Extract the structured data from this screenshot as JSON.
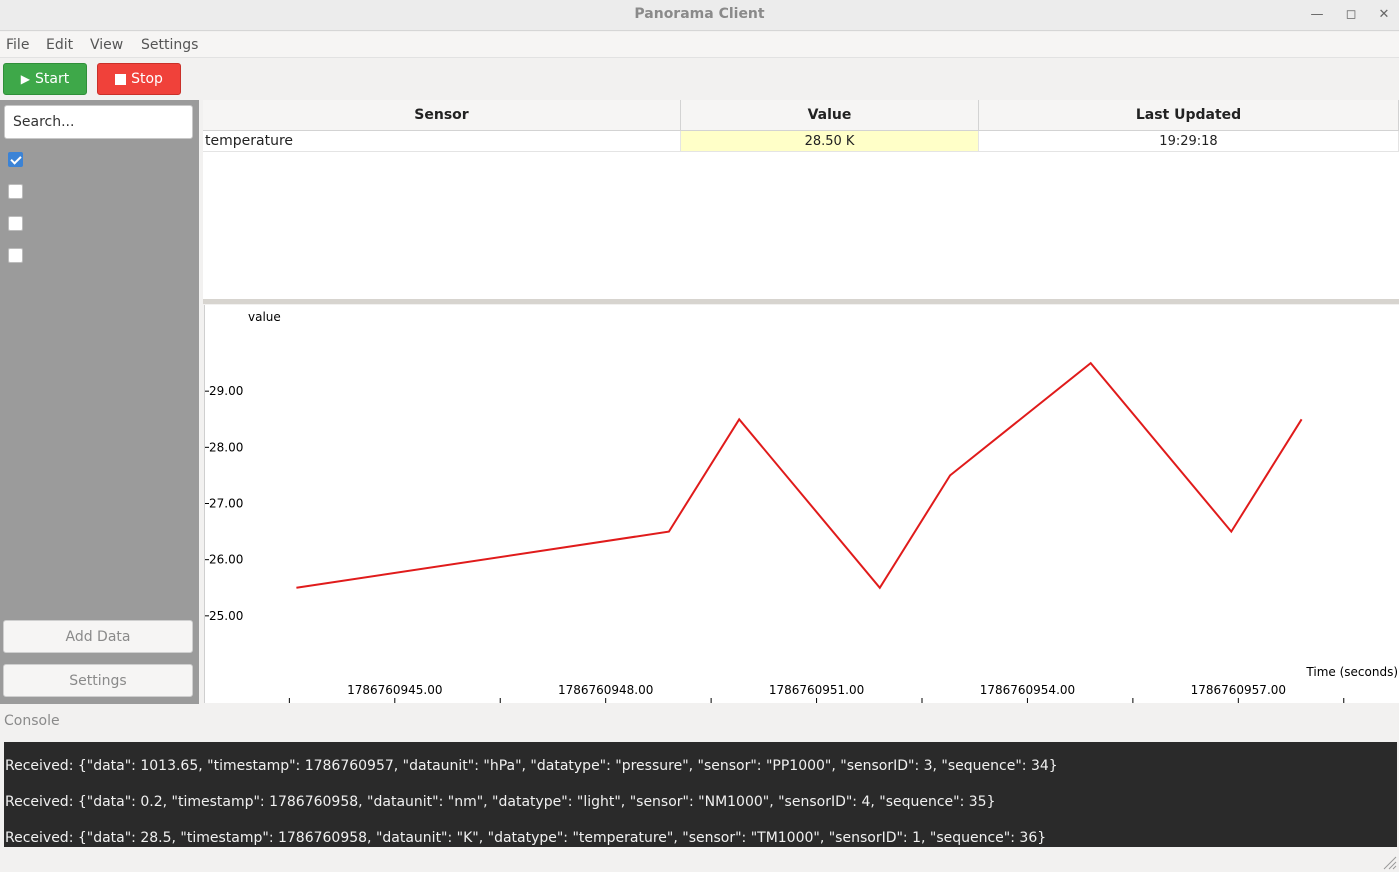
{
  "window": {
    "title": "Panorama Client"
  },
  "menu": [
    "File",
    "Edit",
    "View",
    "Settings"
  ],
  "toolbar": {
    "start_label": "Start",
    "stop_label": "Stop",
    "start_color": "#3ea849",
    "stop_color": "#f0413a"
  },
  "sidebar": {
    "search_placeholder": "Search...",
    "checkboxes": [
      true,
      false,
      false,
      false
    ],
    "add_data_label": "Add Data",
    "settings_label": "Settings"
  },
  "table": {
    "headers": [
      "Sensor",
      "Value",
      "Last Updated"
    ],
    "rows": [
      {
        "sensor": "temperature",
        "value": "28.50 K",
        "updated": "19:29:18"
      }
    ],
    "highlight_color": "#ffffc8"
  },
  "chart_data": {
    "type": "line",
    "ylabel": "value",
    "xlabel": "Time (seconds)",
    "ylim": [
      24.0,
      30.0
    ],
    "xlim": [
      1786760942.3,
      1786760959.3
    ],
    "yticks": [
      "25.00",
      "26.00",
      "27.00",
      "28.00",
      "29.00"
    ],
    "xticks": [
      "1786760945.00",
      "1786760948.00",
      "1786760951.00",
      "1786760954.00",
      "1786760957.00"
    ],
    "series": [
      {
        "color": "#e01b1b",
        "x": [
          1786760943.6,
          1786760948.9,
          1786760949.9,
          1786760951.9,
          1786760952.9,
          1786760954.9,
          1786760956.9,
          1786760957.9
        ],
        "y": [
          25.5,
          26.5,
          28.5,
          25.5,
          27.5,
          29.5,
          26.5,
          28.5
        ]
      }
    ],
    "grid": false
  },
  "console": {
    "label": "Console",
    "lines": [
      "Received: {\"data\": 1013.65, \"timestamp\": 1786760957, \"dataunit\": \"hPa\", \"datatype\": \"pressure\", \"sensor\": \"PP1000\", \"sensorID\": 3, \"sequence\": 34}",
      "Received: {\"data\": 0.2, \"timestamp\": 1786760958, \"dataunit\": \"nm\", \"datatype\": \"light\", \"sensor\": \"NM1000\", \"sensorID\": 4, \"sequence\": 35}",
      "Received: {\"data\": 28.5, \"timestamp\": 1786760958, \"dataunit\": \"K\", \"datatype\": \"temperature\", \"sensor\": \"TM1000\", \"sensorID\": 1, \"sequence\": 36}"
    ]
  }
}
